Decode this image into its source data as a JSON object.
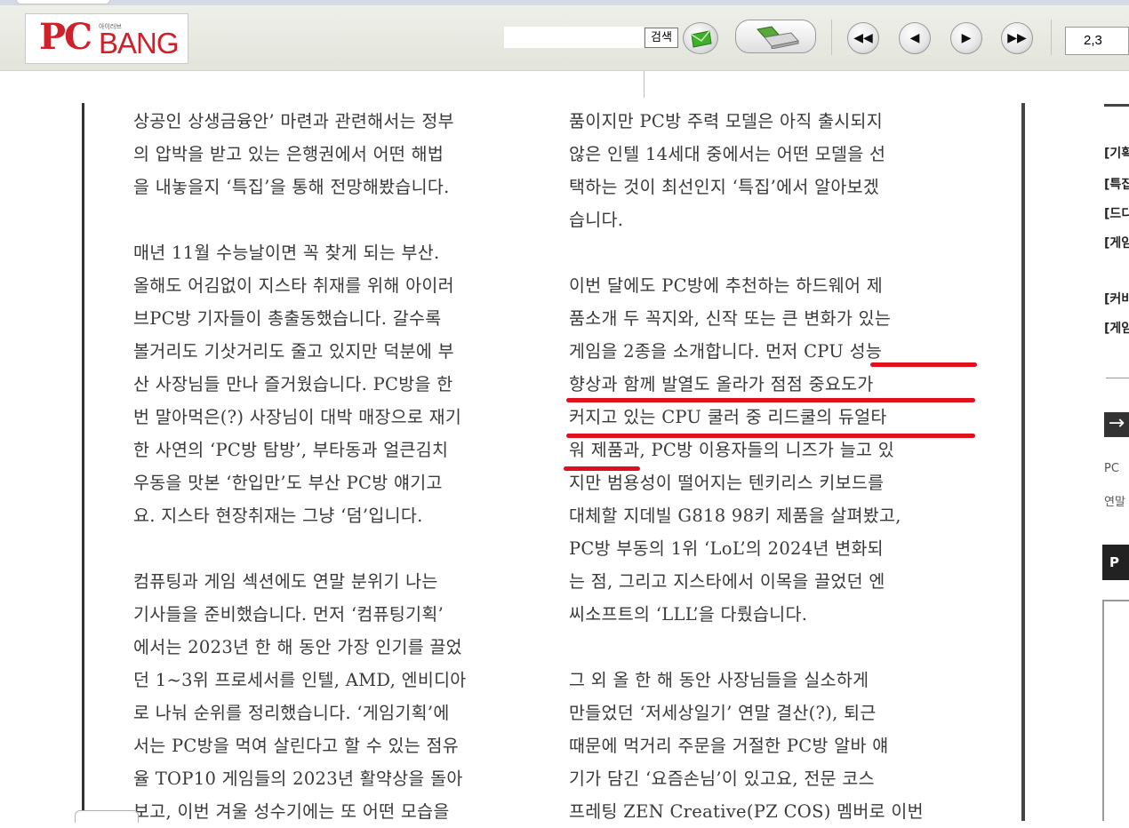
{
  "toolbar": {
    "logo_pc": "PC",
    "logo_bang": "BANG",
    "logo_small": "아이러브",
    "search_value": "",
    "search_label": "검색",
    "page_value": "2,3"
  },
  "article": {
    "left_lines": [
      "상공인 상생금융안’ 마련과 관련해서는 정부",
      "의 압박을 받고 있는 은행권에서 어떤 해법",
      "을 내놓을지 ‘특집’을 통해 전망해봤습니다.",
      "",
      " 매년 11월 수능날이면 꼭 찾게 되는 부산.",
      "올해도 어김없이 지스타 취재를 위해 아이러",
      "브PC방 기자들이 총출동했습니다. 갈수록",
      "볼거리도 기삿거리도 줄고 있지만 덕분에 부",
      "산 사장님들 만나 즐거웠습니다. PC방을 한",
      "번 말아먹은(?) 사장님이 대박 매장으로 재기",
      "한 사연의 ‘PC방 탐방’, 부타동과 얼큰김치",
      "우동을 맛본 ‘한입만’도 부산 PC방 얘기고",
      "요. 지스타 현장취재는 그냥 ‘덤’입니다.",
      "",
      " 컴퓨팅과 게임 섹션에도 연말 분위기 나는",
      "기사들을 준비했습니다. 먼저 ‘컴퓨팅기획’",
      "에서는 2023년 한 해 동안 가장 인기를 끌었",
      "던 1~3위 프로세서를 인텔, AMD, 엔비디아",
      "로 나눠 순위를 정리했습니다. ‘게임기획’에",
      "서는 PC방을 먹여 살린다고 할 수 있는 점유",
      "율 TOP10 게임들의 2023년 활약상을 돌아",
      "보고, 이번 겨울 성수기에는 또 어떤 모습을"
    ],
    "right_lines": [
      "품이지만 PC방 주력 모델은 아직 출시되지",
      "않은 인텔 14세대 중에서는 어떤 모델을 선",
      "택하는 것이 최선인지 ‘특집’에서 알아보겠",
      "습니다.",
      "",
      " 이번 달에도 PC방에 추천하는 하드웨어 제",
      "품소개 두 꼭지와, 신작 또는 큰 변화가 있는",
      "게임을 2종을 소개합니다. 먼저 CPU 성능",
      "향상과 함께 발열도 올라가 점점 중요도가",
      "커지고 있는 CPU 쿨러 중 리드쿨의 듀얼타",
      "워 제품과, PC방 이용자들의 니즈가 늘고 있",
      "지만 범용성이 떨어지는 텐키리스 키보드를",
      "대체할 지데빌 G818 98키 제품을 살펴봤고,",
      "PC방 부동의 1위 ‘LoL’의 2024년 변화되",
      "는 점, 그리고 지스타에서 이목을 끌었던 엔",
      "씨소프트의 ‘LLL’을 다뤘습니다.",
      "",
      " 그 외 올 한 해 동안 사장님들을 실소하게",
      "만들었던 ‘저세상일기’ 연말 결산(?), 퇴근",
      "때문에 먹거리 주문을 거절한 PC방 알바 얘",
      "기가 담긴 ‘요즘손님’이 있고요, 전문 코스",
      "프레팅 ZEN Creative(PZ COS) 멤버로 이번"
    ]
  },
  "sidebar": {
    "items": [
      "[기획",
      "[특집",
      "[드디",
      "[게임"
    ],
    "items2": [
      "[커비",
      "[게임"
    ],
    "small1": "PC",
    "small2": "연말",
    "black_label": "P"
  },
  "colors": {
    "brand_red": "#d0202a",
    "underline_red": "#e0101c"
  }
}
